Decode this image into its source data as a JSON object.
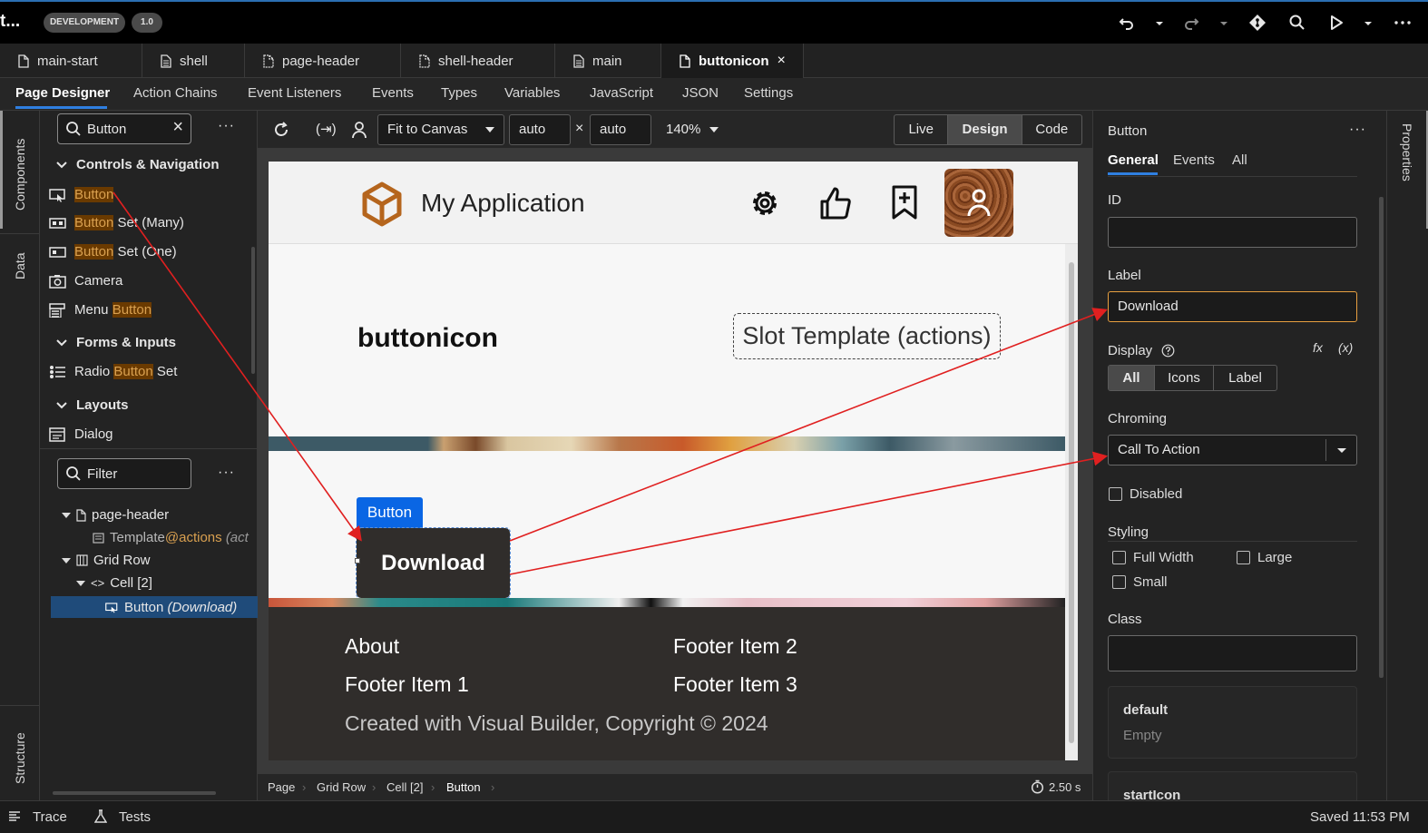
{
  "app": {
    "title": "t...",
    "env_badge": "DEVELOPMENT",
    "version_badge": "1.0"
  },
  "file_tabs": [
    {
      "label": "main-start"
    },
    {
      "label": "shell"
    },
    {
      "label": "page-header"
    },
    {
      "label": "shell-header"
    },
    {
      "label": "main"
    },
    {
      "label": "buttonicon",
      "active": true
    }
  ],
  "designer_tabs": [
    "Page Designer",
    "Action Chains",
    "Event Listeners",
    "Events",
    "Types",
    "Variables",
    "JavaScript",
    "JSON",
    "Settings"
  ],
  "left_rail": {
    "components": "Components",
    "data": "Data",
    "structure": "Structure"
  },
  "components": {
    "search_value": "Button",
    "sections": [
      {
        "title": "Controls & Navigation",
        "items": [
          {
            "hl": "Button",
            "rest": ""
          },
          {
            "hl": "Button",
            "rest": " Set (Many)"
          },
          {
            "hl": "Button",
            "rest": " Set (One)"
          },
          {
            "pre": "Camera"
          },
          {
            "pre": "Menu ",
            "hl": "Button"
          }
        ]
      },
      {
        "title": "Forms & Inputs",
        "items": [
          {
            "pre": "Radio ",
            "hl": "Button",
            "rest": " Set"
          }
        ]
      },
      {
        "title": "Layouts",
        "items": [
          {
            "pre": "Dialog"
          }
        ]
      }
    ]
  },
  "structure": {
    "filter_placeholder": "Filter",
    "nodes": [
      {
        "label": "page-header"
      },
      {
        "label": "Template",
        "slot": "@actions",
        "extra": "(act"
      },
      {
        "label": "Grid Row"
      },
      {
        "label": "Cell [2]"
      },
      {
        "label": "Button",
        "extra": "(Download)",
        "selected": true
      }
    ]
  },
  "canvas_toolbar": {
    "fit": "Fit to Canvas",
    "width": "auto",
    "height": "auto",
    "zoom": "140%",
    "modes": [
      "Live",
      "Design",
      "Code"
    ],
    "active_mode": "Design"
  },
  "preview": {
    "app_title": "My Application",
    "page_title": "buttonicon",
    "slot_template": "Slot Template (actions)",
    "button_tag": "Button",
    "button_label": "Download",
    "footer": {
      "col1": [
        "About",
        "Footer Item 1"
      ],
      "col2": [
        "Footer Item 2",
        "Footer Item 3"
      ],
      "copyright": "Created with Visual Builder, Copyright © 2024"
    }
  },
  "breadcrumbs": [
    "Page",
    "Grid Row",
    "Cell [2]",
    "Button"
  ],
  "render_time": "2.50 s",
  "properties": {
    "title": "Button",
    "tabs": [
      "General",
      "Events",
      "All"
    ],
    "active_tab": "General",
    "id_label": "ID",
    "id_value": "",
    "label_label": "Label",
    "label_value": "Download",
    "display_label": "Display",
    "display_options": [
      "All",
      "Icons",
      "Label"
    ],
    "display_active": "All",
    "fx": "fx",
    "var": "(x)",
    "chroming_label": "Chroming",
    "chroming_value": "Call To Action",
    "disabled": "Disabled",
    "styling_label": "Styling",
    "styling": [
      "Full Width",
      "Large",
      "Small"
    ],
    "class_label": "Class",
    "class_value": "",
    "slot_default": "default",
    "slot_default_value": "Empty",
    "slot_starticon": "startIcon"
  },
  "right_rail": "Properties",
  "status": {
    "trace": "Trace",
    "tests": "Tests",
    "saved": "Saved 11:53 PM"
  },
  "colors": {
    "accent": "#0a66e4",
    "highlight": "#6a3a00",
    "annotation": "#e02020",
    "brand_orange": "#b5651d"
  }
}
